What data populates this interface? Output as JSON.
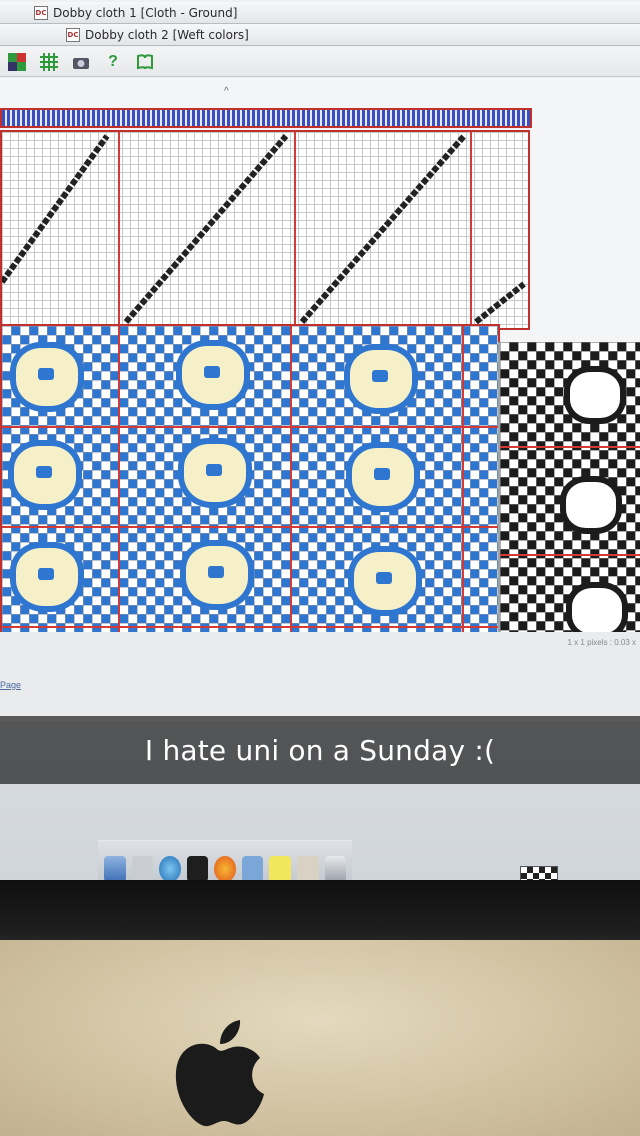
{
  "window_tabs": [
    {
      "icon": "DC",
      "title": "Dobby cloth 1 [Cloth - Ground]"
    },
    {
      "icon": "DC",
      "title": "Dobby cloth 2 [Weft colors]"
    }
  ],
  "toolbar": {
    "buttons": [
      {
        "icon": "palette-icon"
      },
      {
        "icon": "grid-icon"
      },
      {
        "icon": "camera-icon"
      },
      {
        "icon": "help-icon",
        "label": "?"
      },
      {
        "icon": "book-icon"
      }
    ]
  },
  "status_bar": {
    "zoom_text": "1 x 1 pixels : 0.03 x",
    "page_link": "Page"
  },
  "snap_caption": "I hate uni on a Sunday :(",
  "colors": {
    "weft_blue": "#2f76d0",
    "ground_cream": "#f3efd0",
    "repeat_line_red": "#d43a35",
    "warp_strip_blue": "#3a4fbf",
    "preview_black": "#1c1c1c"
  },
  "dock": {
    "icons": [
      "finder-icon",
      "app-icon",
      "safari-icon",
      "terminal-icon",
      "firefox-icon",
      "folder-icon",
      "stickies-icon",
      "preview-icon",
      "trash-icon"
    ]
  }
}
